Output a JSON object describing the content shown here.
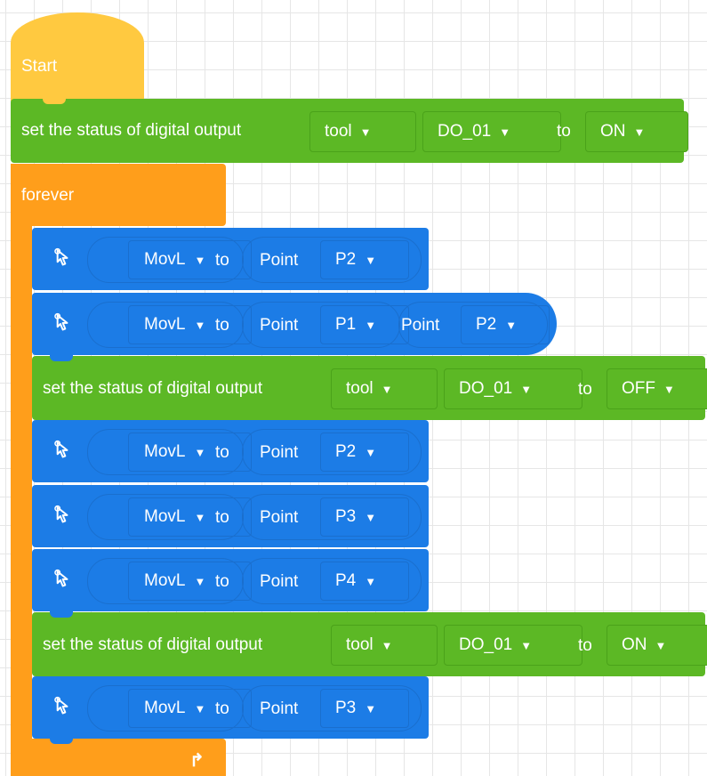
{
  "start": {
    "label": "Start"
  },
  "set_outputs": [
    {
      "prefix": "set the status of digital output",
      "io": "tool",
      "port": "DO_01",
      "to": "to",
      "state": "ON"
    },
    {
      "prefix": "set the status of digital output",
      "io": "tool",
      "port": "DO_01",
      "to": "to",
      "state": "OFF"
    },
    {
      "prefix": "set the status of digital output",
      "io": "tool",
      "port": "DO_01",
      "to": "to",
      "state": "ON"
    }
  ],
  "forever": {
    "label": "forever"
  },
  "moves": [
    {
      "mode": "MovL",
      "to": "to",
      "point_label": "Point",
      "point": "P2"
    },
    {
      "mode": "MovL",
      "to": "to",
      "point_label": "Point",
      "point": "P1",
      "extra_point_label": "Point",
      "extra_point": "P2"
    },
    {
      "mode": "MovL",
      "to": "to",
      "point_label": "Point",
      "point": "P2"
    },
    {
      "mode": "MovL",
      "to": "to",
      "point_label": "Point",
      "point": "P3"
    },
    {
      "mode": "MovL",
      "to": "to",
      "point_label": "Point",
      "point": "P4"
    },
    {
      "mode": "MovL",
      "to": "to",
      "point_label": "Point",
      "point": "P3"
    }
  ],
  "colors": {
    "event": "#FFC940",
    "io": "#5CB825",
    "control": "#FF9E1B",
    "motion": "#1C7CE6"
  }
}
